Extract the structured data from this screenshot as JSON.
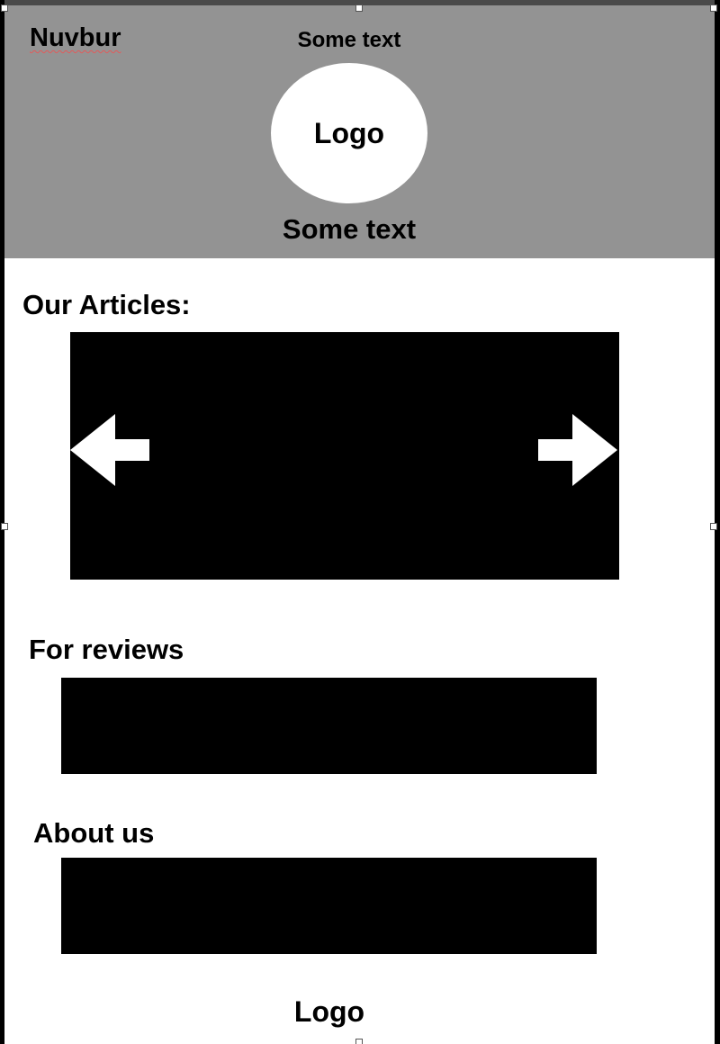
{
  "header": {
    "brand": "Nuvbur",
    "text_top": "Some text",
    "logo_label": "Logo",
    "text_bottom": "Some text",
    "background_color": "#939393"
  },
  "articles": {
    "title": "Our Articles:",
    "prev_icon": "arrow-left-icon",
    "next_icon": "arrow-right-icon"
  },
  "reviews": {
    "title": "For reviews"
  },
  "about": {
    "title": "About us"
  },
  "footer": {
    "logo_label": "Logo"
  }
}
